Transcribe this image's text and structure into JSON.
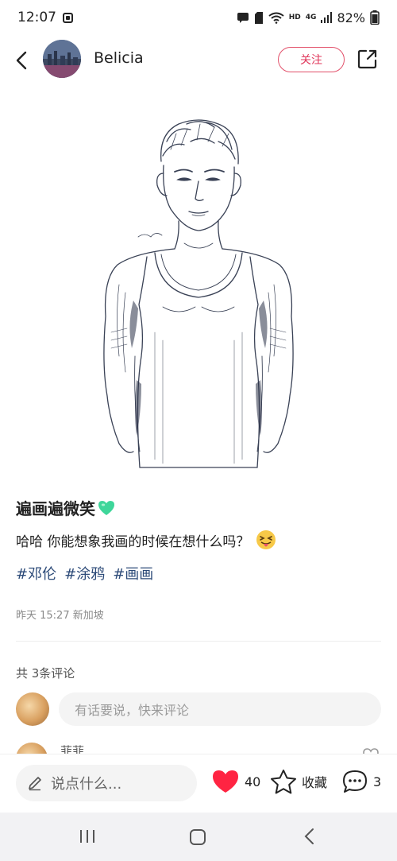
{
  "status_bar": {
    "time": "12:07",
    "battery": "82%",
    "hd_label": "HD",
    "network_label": "4G"
  },
  "header": {
    "author_name": "Belicia",
    "follow_label": "关注"
  },
  "post": {
    "title": "遍画遍微笑",
    "body": "哈哈 你能想象我画的时候在想什么吗？",
    "tags": [
      "#邓伦",
      "#涂鸦",
      "#画画"
    ],
    "meta": "昨天 15:27 新加坡"
  },
  "comments": {
    "count_label": "共 3条评论",
    "input_placeholder": "有话要说，快来评论",
    "first_commenter": "菲菲"
  },
  "action_bar": {
    "say_placeholder": "说点什么...",
    "like_count": "40",
    "favorite_label": "收藏",
    "comment_count": "3"
  },
  "colors": {
    "accent": "#e0365a",
    "heart": "#ff2442",
    "tag": "#2c4a78",
    "emoji_heart": "#3ed69a"
  },
  "icons": [
    "back-arrow-icon",
    "share-icon",
    "pen-icon",
    "heart-icon",
    "star-icon",
    "comment-bubble-icon",
    "green-heart-emoji",
    "tongue-face-emoji"
  ]
}
